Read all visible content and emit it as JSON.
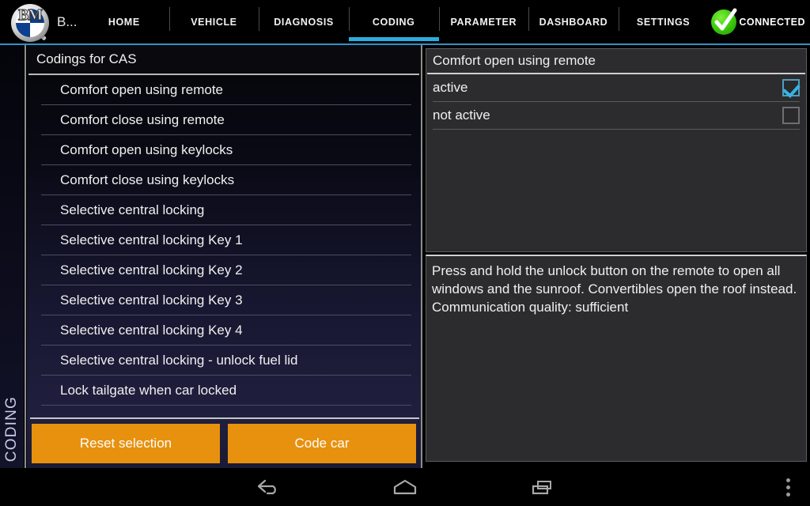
{
  "header": {
    "logo_icon": "bmw-roundel-magnifier-icon",
    "app_title": "B...",
    "tabs": [
      {
        "label": "HOME",
        "active": false
      },
      {
        "label": "VEHICLE",
        "active": false
      },
      {
        "label": "DIAGNOSIS",
        "active": false
      },
      {
        "label": "CODING",
        "active": true
      },
      {
        "label": "PARAMETER",
        "active": false
      },
      {
        "label": "DASHBOARD",
        "active": false
      },
      {
        "label": "SETTINGS",
        "active": false
      }
    ],
    "connection": {
      "label": "CONNECTED",
      "icon": "green-check-circle-icon",
      "color": "#39c60a"
    },
    "accent_color": "#2bade0"
  },
  "side_label": "CODING",
  "left_panel": {
    "title": "Codings for CAS",
    "items": [
      "Comfort open using remote",
      "Comfort close using remote",
      "Comfort open using keylocks",
      "Comfort close using keylocks",
      "Selective central locking",
      "Selective central locking Key 1",
      "Selective central locking Key 2",
      "Selective central locking Key 3",
      "Selective central locking Key 4",
      "Selective central locking - unlock fuel lid",
      "Lock tailgate when car locked"
    ],
    "buttons": [
      {
        "label": "Reset selection",
        "color": "#e8910e"
      },
      {
        "label": "Code car",
        "color": "#e8910e"
      }
    ]
  },
  "right_panel": {
    "title": "Comfort open using remote",
    "options": [
      {
        "label": "active",
        "checked": true
      },
      {
        "label": "not active",
        "checked": false
      }
    ],
    "description": "Press and hold the unlock button on the remote to open all windows and the sunroof. Convertibles open the roof instead.\nCommunication quality: sufficient"
  },
  "navbar": {
    "back_icon": "back-arrow-icon",
    "home_icon": "home-pentagon-icon",
    "recents_icon": "recents-squares-icon",
    "overflow_icon": "overflow-menu-icon"
  }
}
